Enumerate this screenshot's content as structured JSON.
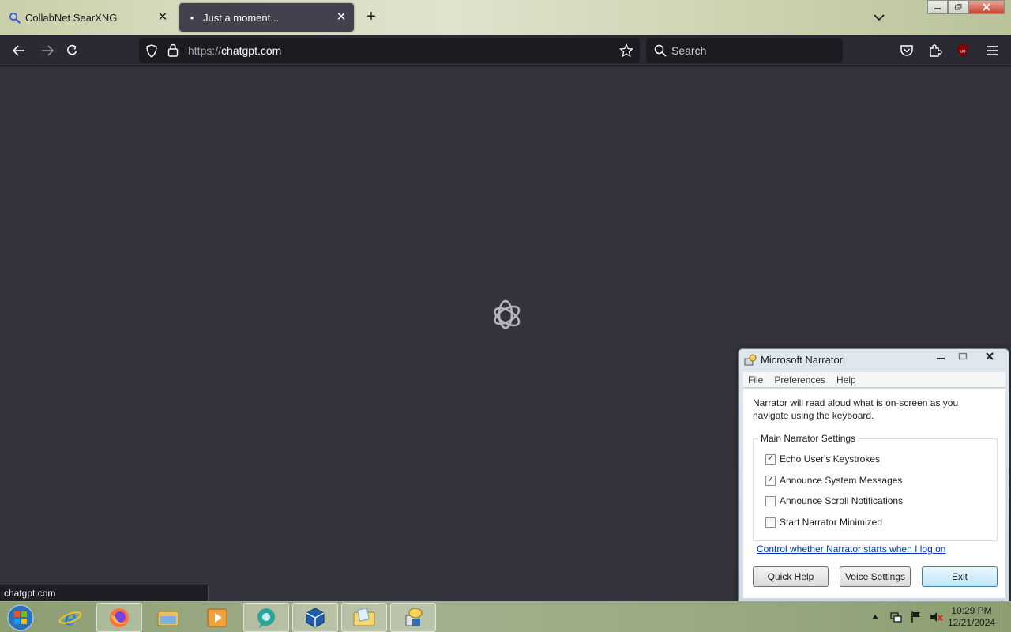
{
  "browser": {
    "tabs": [
      {
        "title": "CollabNet SearXNG",
        "icon": "search-icon",
        "active": false
      },
      {
        "title": "Just a moment...",
        "icon": "loading-dot-icon",
        "active": true
      }
    ],
    "url_scheme": "https://",
    "url_host": "chatgpt.com",
    "search_placeholder": "Search",
    "status_text": "chatgpt.com"
  },
  "narrator": {
    "title": "Microsoft Narrator",
    "menu": [
      "File",
      "Preferences",
      "Help"
    ],
    "description": "Narrator will read aloud what is on-screen as you navigate using the keyboard.",
    "group_title": "Main Narrator Settings",
    "options": [
      {
        "label": "Echo User's Keystrokes",
        "checked": true
      },
      {
        "label": "Announce System Messages",
        "checked": true
      },
      {
        "label": "Announce Scroll Notifications",
        "checked": false
      },
      {
        "label": "Start Narrator Minimized",
        "checked": false
      }
    ],
    "link": "Control whether Narrator starts when I log on",
    "buttons": {
      "quick_help": "Quick Help",
      "voice_settings": "Voice Settings",
      "exit": "Exit"
    }
  },
  "taskbar": {
    "apps": [
      "internet-explorer-icon",
      "firefox-icon",
      "file-explorer-icon",
      "media-player-icon",
      "chat-app-icon",
      "virtualbox-icon",
      "folder-icon",
      "narrator-icon"
    ],
    "time": "10:29 PM",
    "date": "12/21/2024"
  },
  "colors": {
    "page_background": "#33333d",
    "toolbar_background": "#2b2a33",
    "urlbar_background": "#1c1b22",
    "link_color": "#0033cc"
  }
}
